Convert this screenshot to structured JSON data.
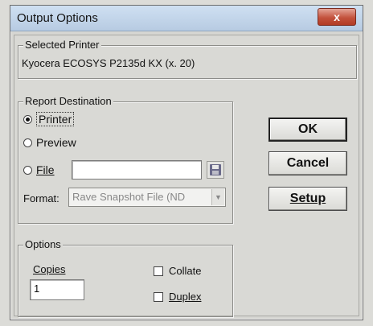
{
  "window": {
    "title": "Output Options",
    "close_glyph": "x"
  },
  "printer_group": {
    "legend": "Selected Printer",
    "name": "Kyocera ECOSYS P2135d KX (x. 20)"
  },
  "destination_group": {
    "legend": "Report Destination",
    "options": [
      {
        "label": "Printer",
        "selected": true
      },
      {
        "label": "Preview",
        "selected": false
      },
      {
        "label": "File",
        "selected": false
      }
    ],
    "file_value": "",
    "format_label": "Format:",
    "format_value": "Rave Snapshot File (ND"
  },
  "buttons": {
    "ok": "OK",
    "cancel": "Cancel",
    "setup": "Setup"
  },
  "options_group": {
    "legend": "Options",
    "copies_label": "Copies",
    "copies_value": "1",
    "collate_label": "Collate",
    "duplex_label": "Duplex"
  },
  "icons": {
    "save": "floppy-disk-icon",
    "dropdown": "chevron-down-icon"
  }
}
